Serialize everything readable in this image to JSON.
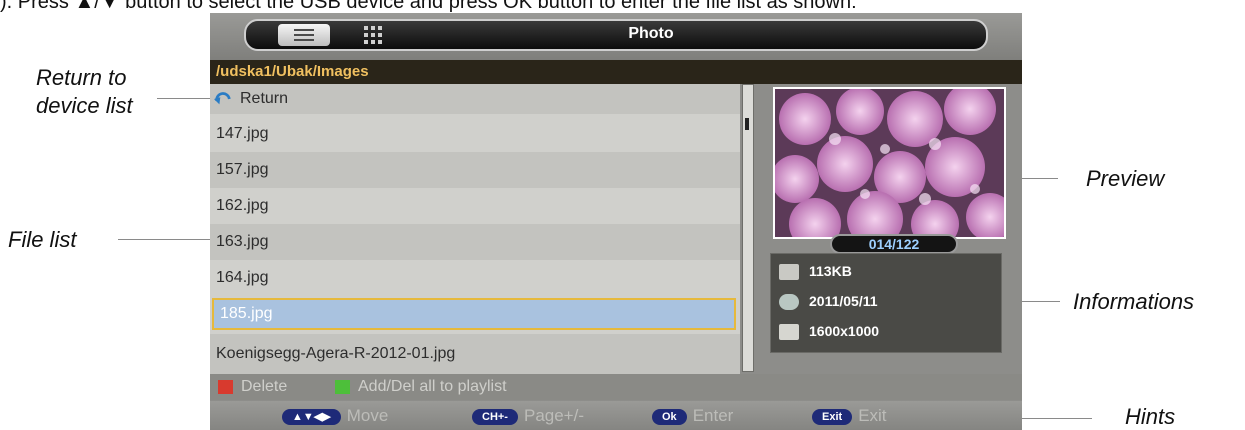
{
  "intro_text": "). Press ▲/▼ button to select the USB device and press OK button to enter the file list as shown:",
  "callouts": {
    "return_line1": "Return to",
    "return_line2": "device list",
    "file_list": "File list",
    "preview": "Preview",
    "informations": "Informations",
    "hints": "Hints"
  },
  "screen": {
    "title": "Photo",
    "path": "/udska1/Ubak/Images",
    "view_modes": [
      "list-view-icon",
      "grid-view-icon"
    ],
    "files": [
      {
        "label": "Return",
        "icon": "return-arrow-icon"
      },
      {
        "label": "147.jpg"
      },
      {
        "label": "157.jpg"
      },
      {
        "label": "162.jpg"
      },
      {
        "label": "163.jpg"
      },
      {
        "label": "164.jpg"
      },
      {
        "label": "185.jpg",
        "selected": true
      },
      {
        "label": "Koenigsegg-Agera-R-2012-01.jpg"
      }
    ],
    "counter": "014/122",
    "info": {
      "size": "113KB",
      "date": "2011/05/11",
      "resolution": "1600x1000"
    },
    "color_hints": {
      "red_label": "Delete",
      "green_label": "Add/Del all to playlist",
      "red_color": "#d83a2e",
      "green_color": "#4dbf3a"
    },
    "nav_hints": {
      "move_key": "▲▼◀▶",
      "move_label": "Move",
      "page_key": "CH+-",
      "page_label": "Page+/-",
      "ok_key": "Ok",
      "ok_label": "Enter",
      "exit_key": "Exit",
      "exit_label": "Exit"
    },
    "colors": {
      "accent_path": "#f0c060",
      "selection": "#a9c2df",
      "selection_border": "#e6b93c",
      "key_bg": "#1e2a78"
    }
  }
}
